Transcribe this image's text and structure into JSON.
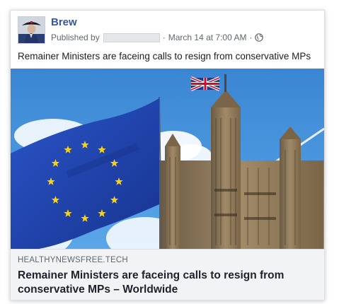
{
  "post": {
    "author": "Brew",
    "published_by": "Published by",
    "timestamp": "March 14 at 7:00 AM",
    "separator": "·",
    "audience_icon": "globe-icon",
    "text": "Remainer Ministers are faceing calls to resign from conservative MPs"
  },
  "link_preview": {
    "image_subject": "EU flag in front of the Victoria Tower of the Palace of Westminster with a Union Jack on top",
    "domain": "HEALTHYNEWSFREE.TECH",
    "headline": "Remainer Ministers are faceing calls to resign from conservative MPs – Worldwide"
  },
  "colors": {
    "author_link": "#365899",
    "meta_text": "#606770",
    "preview_background": "#f2f3f5",
    "sky": "#3f8fd8",
    "eu_flag": "#1f47b8",
    "eu_stars": "#f7d117"
  }
}
